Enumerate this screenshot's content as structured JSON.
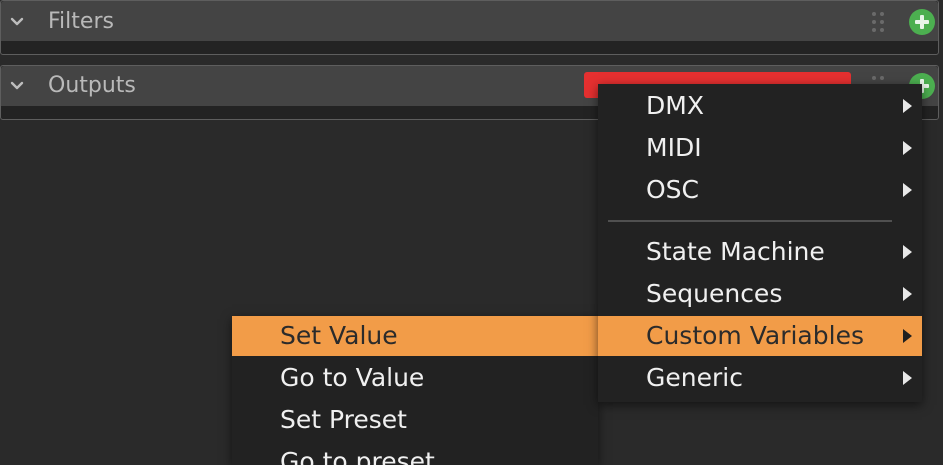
{
  "panels": {
    "filters": {
      "title": "Filters"
    },
    "outputs": {
      "title": "Outputs"
    }
  },
  "main_menu": {
    "items": [
      {
        "label": "DMX",
        "submenu": true
      },
      {
        "label": "MIDI",
        "submenu": true
      },
      {
        "label": "OSC",
        "submenu": true
      },
      {
        "label": "State Machine",
        "submenu": true
      },
      {
        "label": "Sequences",
        "submenu": true
      },
      {
        "label": "Custom Variables",
        "submenu": true,
        "active": true
      },
      {
        "label": "Generic",
        "submenu": true
      }
    ]
  },
  "sub_menu": {
    "items": [
      {
        "label": "Set Value",
        "active": true
      },
      {
        "label": "Go to Value"
      },
      {
        "label": "Set Preset"
      },
      {
        "label": "Go to preset"
      }
    ]
  },
  "colors": {
    "background": "#2a2a2a",
    "panel_header": "#444444",
    "menu_background": "#222222",
    "highlight": "#f29c48",
    "add_button": "#4caf50",
    "alert_bar": "#e53030"
  },
  "icons": [
    "chevron-down-icon",
    "drag-grip-icon",
    "add-circle-icon",
    "submenu-arrow-icon"
  ]
}
